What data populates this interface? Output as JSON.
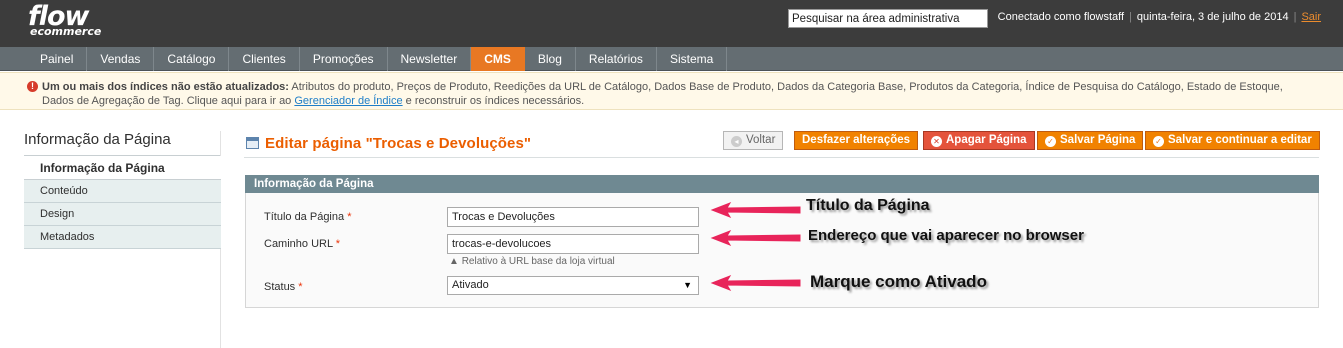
{
  "header": {
    "logo_main": "flow",
    "logo_sub": "ecommerce",
    "search_value": "Pesquisar na área administrativa",
    "logged_in": "Conectado como flowstaff",
    "date": "quinta-feira, 3 de julho de 2014",
    "logout": "Sair"
  },
  "nav": {
    "items": [
      "Painel",
      "Vendas",
      "Catálogo",
      "Clientes",
      "Promoções",
      "Newsletter",
      "CMS",
      "Blog",
      "Relatórios",
      "Sistema"
    ],
    "active": "CMS"
  },
  "notice": {
    "bold": "Um ou mais dos índices não estão atualizados:",
    "text": " Atributos do produto, Preços de Produto, Reedições da URL de Catálogo, Dados Base de Produto, Dados da Categoria Base, Produtos da Categoria, Índice de Pesquisa do Catálogo, Estado de Estoque, Dados de Agregação de Tag. Clique aqui para ir ao ",
    "link": "Gerenciador de Índice",
    "tail": " e reconstruir os índices necessários."
  },
  "sidebar": {
    "title": "Informação da Página",
    "tabs": [
      "Informação da Página",
      "Conteúdo",
      "Design",
      "Metadados"
    ]
  },
  "page": {
    "title": "Editar página \"Trocas e Devoluções\"",
    "buttons": {
      "back": "Voltar",
      "reset": "Desfazer alterações",
      "delete": "Apagar Página",
      "save": "Salvar Página",
      "save_continue": "Salvar e continuar a editar"
    }
  },
  "form": {
    "section_title": "Informação da Página",
    "title_label": "Título da Página",
    "title_value": "Trocas e Devoluções",
    "url_label": "Caminho URL",
    "url_value": "trocas-e-devolucoes",
    "url_note": "Relativo à URL base da loja virtual",
    "status_label": "Status",
    "status_value": "Ativado",
    "required_mark": "*"
  },
  "annotations": {
    "title": "Título da Página",
    "url": "Endereço que vai aparecer no browser",
    "status": "Marque como Ativado"
  },
  "colors": {
    "accent": "#eb5e00",
    "nav_active": "#e87823",
    "header_bg": "#3c3c3c",
    "nav_bg": "#646d72",
    "annotation_arrow": "#e8245a"
  }
}
